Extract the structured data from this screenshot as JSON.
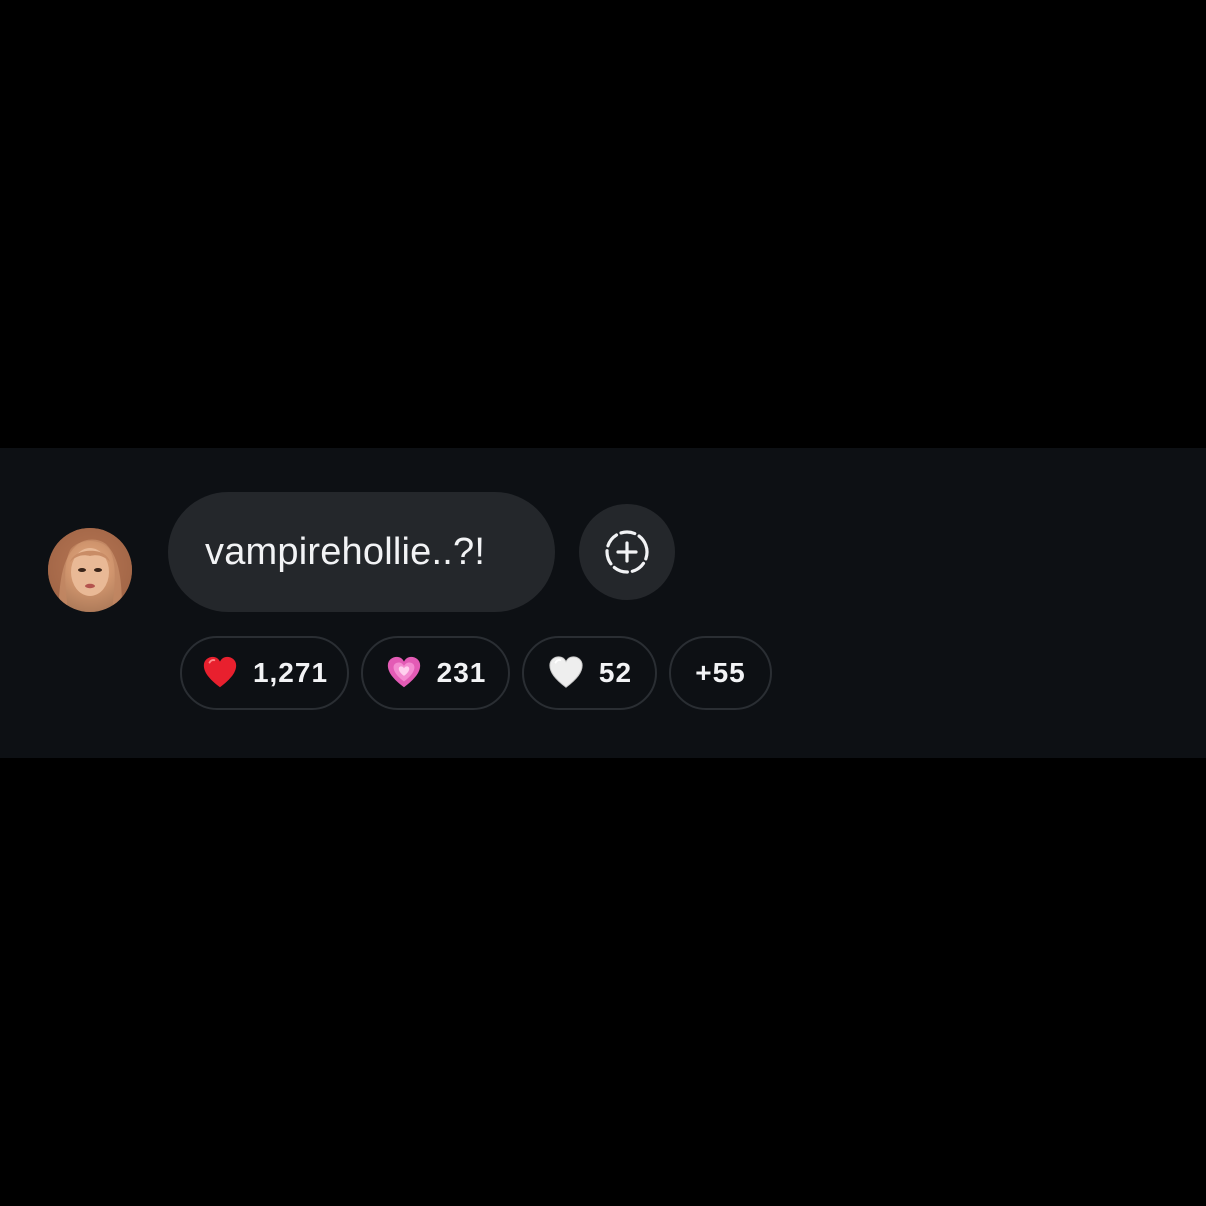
{
  "comment": {
    "text": "vampirehollie..?!"
  },
  "reactions": [
    {
      "icon": "red-heart-icon",
      "count": "1,271"
    },
    {
      "icon": "sparkling-pink-heart-icon",
      "count": "231"
    },
    {
      "icon": "white-heart-icon",
      "count": "52"
    }
  ],
  "more_reactions": "+55",
  "colors": {
    "background": "#000000",
    "band": "#0d1014",
    "bubble": "#24272b",
    "text": "#f2f3f5"
  }
}
